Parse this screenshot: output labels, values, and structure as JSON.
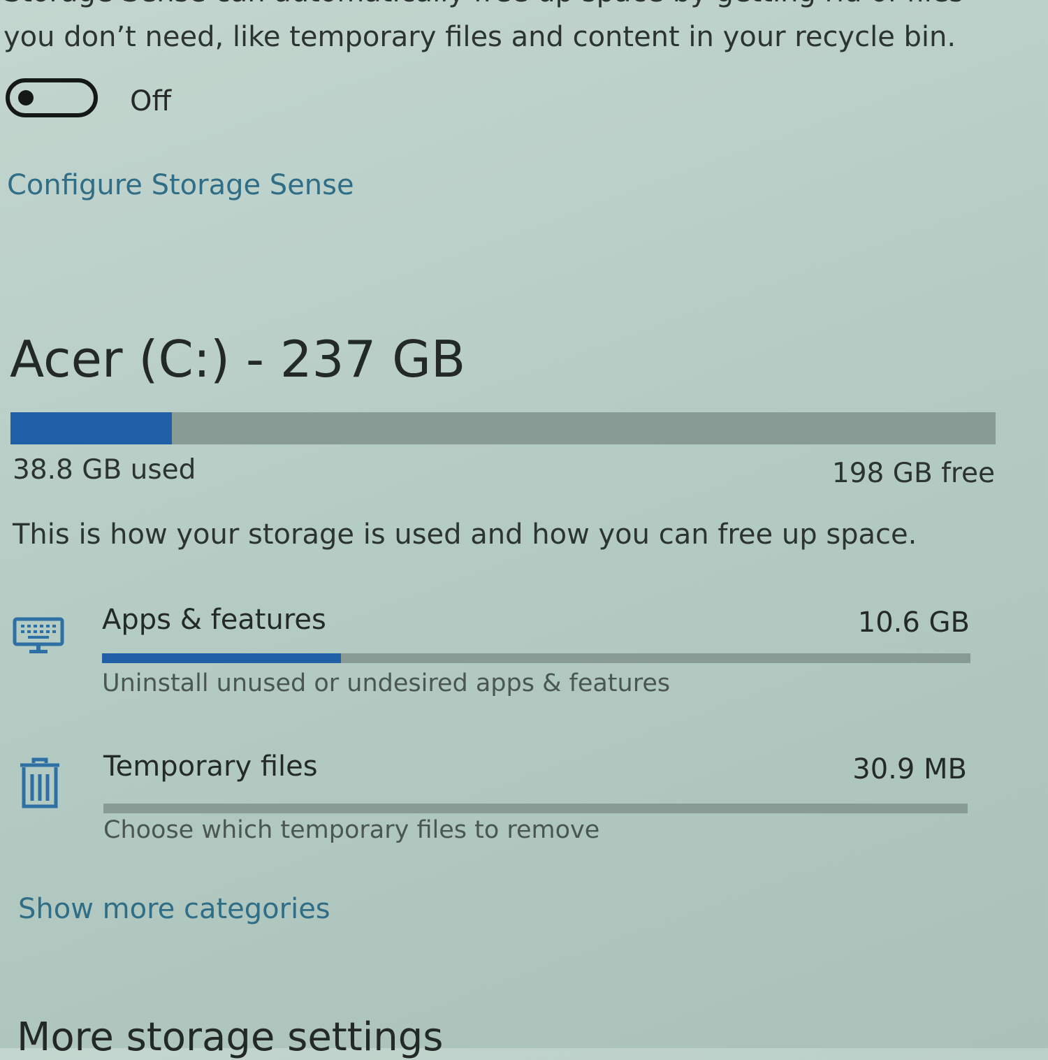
{
  "storage_sense": {
    "description_line1": "Storage Sense can automatically free up space by getting rid of files",
    "description_line2": "you don’t need, like temporary files and content in your recycle bin.",
    "toggle_state": "Off",
    "toggle_on": false,
    "configure_link": "Configure Storage Sense"
  },
  "drive": {
    "title": "Acer (C:) - 237 GB",
    "used_label": "38.8 GB used",
    "free_label": "198 GB free",
    "used_fraction": 0.164,
    "bar_color": "#205fa6"
  },
  "intro": "This is how your storage is used and how you can free up space.",
  "categories": [
    {
      "name": "Apps & features",
      "size": "10.6 GB",
      "subtext": "Uninstall unused or undesired apps & features",
      "icon": "keyboard-icon",
      "fill_fraction": 0.275
    },
    {
      "name": "Temporary files",
      "size": "30.9 MB",
      "subtext": "Choose which temporary files to remove",
      "icon": "trash-icon",
      "fill_fraction": 0.0
    }
  ],
  "show_more_link": "Show more categories",
  "more_settings_heading": "More storage settings",
  "colors": {
    "link": "#2f6e86",
    "accent": "#205fa6",
    "track": "#889c95"
  }
}
